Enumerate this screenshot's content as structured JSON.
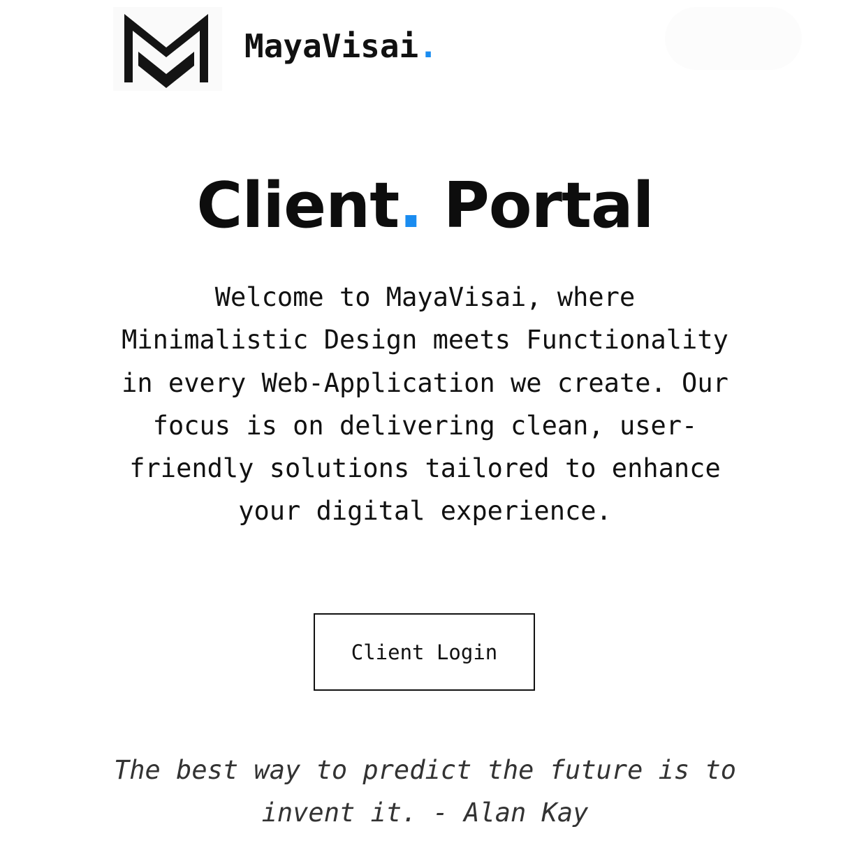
{
  "header": {
    "brand_name": "MayaVisai",
    "brand_dot": ".",
    "logo_icon": "maya-m-logo-icon"
  },
  "hero": {
    "title_part1": "Client",
    "title_dot": ".",
    "title_part2": " Portal",
    "intro": "Welcome to MayaVisai, where Minimalistic Design meets Functionality in every Web-Application we create. Our focus is on delivering clean, user-friendly solutions tailored to enhance your digital experience."
  },
  "actions": {
    "login_label": "Client Login"
  },
  "quote": {
    "text": "The best way to predict the future is to invent it. - Alan Kay"
  },
  "colors": {
    "accent": "#1a8cf0",
    "text": "#111111",
    "background": "#ffffff"
  }
}
